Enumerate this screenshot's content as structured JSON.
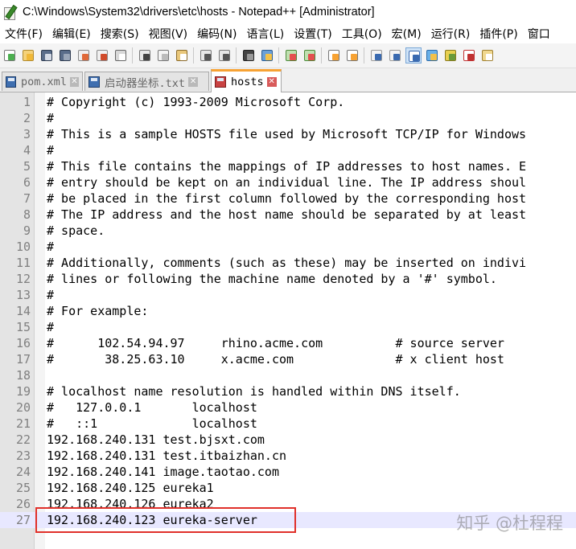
{
  "window": {
    "title": "C:\\Windows\\System32\\drivers\\etc\\hosts - Notepad++ [Administrator]"
  },
  "menu": {
    "items": [
      "文件(F)",
      "编辑(E)",
      "搜索(S)",
      "视图(V)",
      "编码(N)",
      "语言(L)",
      "设置(T)",
      "工具(O)",
      "宏(M)",
      "运行(R)",
      "插件(P)",
      "窗口"
    ]
  },
  "toolbar": {
    "icons": [
      "new-file-icon",
      "open-file-icon",
      "save-icon",
      "save-all-icon",
      "close-icon",
      "close-all-icon",
      "print-icon",
      "cut-icon",
      "copy-icon",
      "paste-icon",
      "undo-icon",
      "redo-icon",
      "find-icon",
      "replace-icon",
      "zoom-in-icon",
      "zoom-out-icon",
      "sync-vertical-icon",
      "sync-horizontal-icon",
      "word-wrap-icon",
      "show-all-chars-icon",
      "indent-guide-icon",
      "user-defined-lang-icon",
      "document-map-icon",
      "function-list-icon",
      "folder-as-workspace-icon"
    ]
  },
  "tabs": [
    {
      "label": "pom.xml",
      "close": "✕"
    },
    {
      "label": "启动器坐标.txt",
      "close": "✕"
    },
    {
      "label": "hosts",
      "close": "✕"
    }
  ],
  "editor": {
    "current_line": 27,
    "lines": [
      {
        "n": "1",
        "text": "# Copyright (c) 1993-2009 Microsoft Corp."
      },
      {
        "n": "2",
        "text": "#"
      },
      {
        "n": "3",
        "text": "# This is a sample HOSTS file used by Microsoft TCP/IP for Windows"
      },
      {
        "n": "4",
        "text": "#"
      },
      {
        "n": "5",
        "text": "# This file contains the mappings of IP addresses to host names. E"
      },
      {
        "n": "6",
        "text": "# entry should be kept on an individual line. The IP address shoul"
      },
      {
        "n": "7",
        "text": "# be placed in the first column followed by the corresponding host"
      },
      {
        "n": "8",
        "text": "# The IP address and the host name should be separated by at least"
      },
      {
        "n": "9",
        "text": "# space."
      },
      {
        "n": "10",
        "text": "#"
      },
      {
        "n": "11",
        "text": "# Additionally, comments (such as these) may be inserted on indivi"
      },
      {
        "n": "12",
        "text": "# lines or following the machine name denoted by a '#' symbol."
      },
      {
        "n": "13",
        "text": "#"
      },
      {
        "n": "14",
        "text": "# For example:"
      },
      {
        "n": "15",
        "text": "#"
      },
      {
        "n": "16",
        "text": "#      102.54.94.97     rhino.acme.com          # source server"
      },
      {
        "n": "17",
        "text": "#       38.25.63.10     x.acme.com              # x client host"
      },
      {
        "n": "18",
        "text": ""
      },
      {
        "n": "19",
        "text": "# localhost name resolution is handled within DNS itself."
      },
      {
        "n": "20",
        "text": "#   127.0.0.1       localhost"
      },
      {
        "n": "21",
        "text": "#   ::1             localhost"
      },
      {
        "n": "22",
        "text": "192.168.240.131 test.bjsxt.com"
      },
      {
        "n": "23",
        "text": "192.168.240.131 test.itbaizhan.cn"
      },
      {
        "n": "24",
        "text": "192.168.240.141 image.taotao.com"
      },
      {
        "n": "25",
        "text": "192.168.240.125 eureka1"
      },
      {
        "n": "26",
        "text": "192.168.240.126 eureka2"
      },
      {
        "n": "27",
        "text": "192.168.240.123 eureka-server"
      }
    ]
  },
  "watermark": "知乎 @杜程程",
  "colors": {
    "highlight_box": "#e0302a",
    "current_line": "#e8e8ff",
    "active_tab_accent": "#f7a233"
  }
}
